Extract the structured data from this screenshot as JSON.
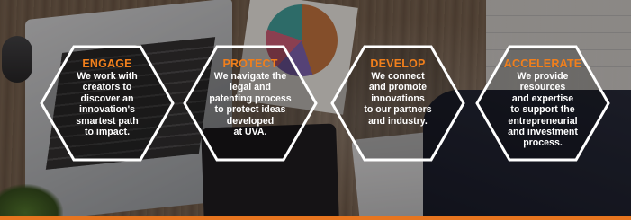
{
  "colors": {
    "accent": "#f07f1c",
    "hexagon_stroke": "#ffffff",
    "body_text": "#ffffff"
  },
  "panels": [
    {
      "title": "ENGAGE",
      "text": "We work with\ncreators to\ndiscover an\ninnovation's\nsmartest path\nto impact."
    },
    {
      "title": "PROTECT",
      "text": "We navigate the\nlegal and\npatenting process\nto protect ideas\ndeveloped\nat UVA."
    },
    {
      "title": "DEVELOP",
      "text": "We connect\nand promote\ninnovations\nto our partners\nand industry."
    },
    {
      "title": "ACCELERATE",
      "text": "We provide\nresources\nand expertise\nto support the\nentrepreneurial\nand investment\nprocess."
    }
  ]
}
